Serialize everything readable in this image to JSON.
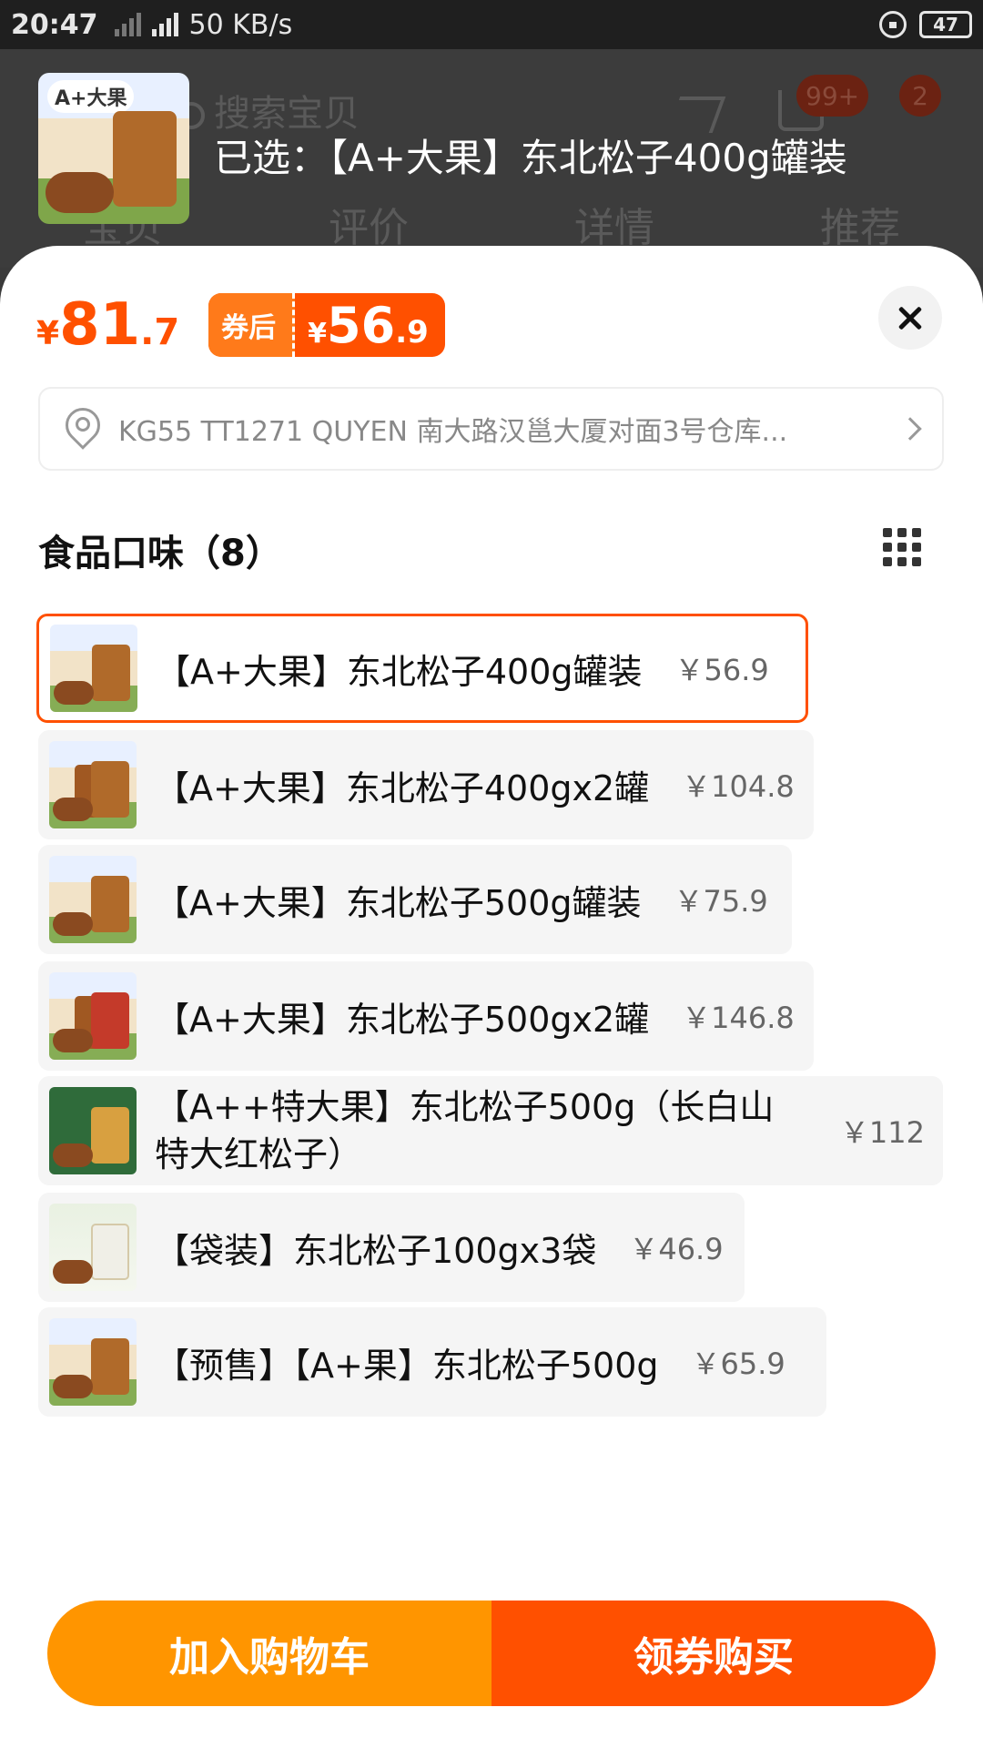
{
  "status_bar": {
    "time": "20:47",
    "network": "4G",
    "speed": "50 KB/s",
    "battery": "47"
  },
  "background": {
    "search_placeholder": "搜索宝贝",
    "cart_badge": "99+",
    "more_badge": "2",
    "tabs": [
      "宝贝",
      "评价",
      "详情",
      "推荐"
    ]
  },
  "selected": {
    "thumb_title": "A+大果",
    "text": "已选：【A+大果】东北松子400g罐装"
  },
  "price": {
    "currency": "¥",
    "integer": "81",
    "decimal": ".7"
  },
  "coupon": {
    "label": "券后",
    "currency": "¥",
    "integer": "56",
    "decimal": ".9"
  },
  "address": {
    "text": "KG55 TT1271 QUYEN 南大路汉邕大厦对面3号仓库..."
  },
  "section": {
    "title": "食品口味（8）"
  },
  "options": [
    {
      "name": "【A+大果】东北松子400g罐装",
      "price": "￥56.9",
      "selected": true
    },
    {
      "name": "【A+大果】东北松子400gx2罐",
      "price": "￥104.8",
      "selected": false
    },
    {
      "name": "【A+大果】东北松子500g罐装",
      "price": "￥75.9",
      "selected": false
    },
    {
      "name": "【A+大果】东北松子500gx2罐",
      "price": "￥146.8",
      "selected": false
    },
    {
      "name": "【A++特大果】东北松子500g（长白山特大红松子）",
      "price": "￥112",
      "selected": false
    },
    {
      "name": "【袋装】东北松子100gx3袋",
      "price": "￥46.9",
      "selected": false
    },
    {
      "name": "【预售】【A+果】东北松子500g",
      "price": "￥65.9",
      "selected": false
    }
  ],
  "actions": {
    "add_to_cart": "加入购物车",
    "buy": "领券购买"
  },
  "colors": {
    "accent": "#ff5000",
    "secondary": "#ff9500"
  }
}
